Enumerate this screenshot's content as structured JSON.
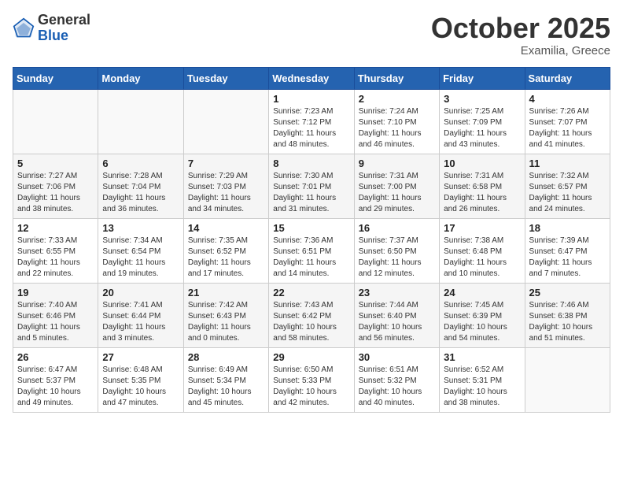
{
  "header": {
    "logo_general": "General",
    "logo_blue": "Blue",
    "month": "October 2025",
    "location": "Examilia, Greece"
  },
  "days_of_week": [
    "Sunday",
    "Monday",
    "Tuesday",
    "Wednesday",
    "Thursday",
    "Friday",
    "Saturday"
  ],
  "weeks": [
    [
      {
        "day": "",
        "detail": ""
      },
      {
        "day": "",
        "detail": ""
      },
      {
        "day": "",
        "detail": ""
      },
      {
        "day": "1",
        "detail": "Sunrise: 7:23 AM\nSunset: 7:12 PM\nDaylight: 11 hours\nand 48 minutes."
      },
      {
        "day": "2",
        "detail": "Sunrise: 7:24 AM\nSunset: 7:10 PM\nDaylight: 11 hours\nand 46 minutes."
      },
      {
        "day": "3",
        "detail": "Sunrise: 7:25 AM\nSunset: 7:09 PM\nDaylight: 11 hours\nand 43 minutes."
      },
      {
        "day": "4",
        "detail": "Sunrise: 7:26 AM\nSunset: 7:07 PM\nDaylight: 11 hours\nand 41 minutes."
      }
    ],
    [
      {
        "day": "5",
        "detail": "Sunrise: 7:27 AM\nSunset: 7:06 PM\nDaylight: 11 hours\nand 38 minutes."
      },
      {
        "day": "6",
        "detail": "Sunrise: 7:28 AM\nSunset: 7:04 PM\nDaylight: 11 hours\nand 36 minutes."
      },
      {
        "day": "7",
        "detail": "Sunrise: 7:29 AM\nSunset: 7:03 PM\nDaylight: 11 hours\nand 34 minutes."
      },
      {
        "day": "8",
        "detail": "Sunrise: 7:30 AM\nSunset: 7:01 PM\nDaylight: 11 hours\nand 31 minutes."
      },
      {
        "day": "9",
        "detail": "Sunrise: 7:31 AM\nSunset: 7:00 PM\nDaylight: 11 hours\nand 29 minutes."
      },
      {
        "day": "10",
        "detail": "Sunrise: 7:31 AM\nSunset: 6:58 PM\nDaylight: 11 hours\nand 26 minutes."
      },
      {
        "day": "11",
        "detail": "Sunrise: 7:32 AM\nSunset: 6:57 PM\nDaylight: 11 hours\nand 24 minutes."
      }
    ],
    [
      {
        "day": "12",
        "detail": "Sunrise: 7:33 AM\nSunset: 6:55 PM\nDaylight: 11 hours\nand 22 minutes."
      },
      {
        "day": "13",
        "detail": "Sunrise: 7:34 AM\nSunset: 6:54 PM\nDaylight: 11 hours\nand 19 minutes."
      },
      {
        "day": "14",
        "detail": "Sunrise: 7:35 AM\nSunset: 6:52 PM\nDaylight: 11 hours\nand 17 minutes."
      },
      {
        "day": "15",
        "detail": "Sunrise: 7:36 AM\nSunset: 6:51 PM\nDaylight: 11 hours\nand 14 minutes."
      },
      {
        "day": "16",
        "detail": "Sunrise: 7:37 AM\nSunset: 6:50 PM\nDaylight: 11 hours\nand 12 minutes."
      },
      {
        "day": "17",
        "detail": "Sunrise: 7:38 AM\nSunset: 6:48 PM\nDaylight: 11 hours\nand 10 minutes."
      },
      {
        "day": "18",
        "detail": "Sunrise: 7:39 AM\nSunset: 6:47 PM\nDaylight: 11 hours\nand 7 minutes."
      }
    ],
    [
      {
        "day": "19",
        "detail": "Sunrise: 7:40 AM\nSunset: 6:46 PM\nDaylight: 11 hours\nand 5 minutes."
      },
      {
        "day": "20",
        "detail": "Sunrise: 7:41 AM\nSunset: 6:44 PM\nDaylight: 11 hours\nand 3 minutes."
      },
      {
        "day": "21",
        "detail": "Sunrise: 7:42 AM\nSunset: 6:43 PM\nDaylight: 11 hours\nand 0 minutes."
      },
      {
        "day": "22",
        "detail": "Sunrise: 7:43 AM\nSunset: 6:42 PM\nDaylight: 10 hours\nand 58 minutes."
      },
      {
        "day": "23",
        "detail": "Sunrise: 7:44 AM\nSunset: 6:40 PM\nDaylight: 10 hours\nand 56 minutes."
      },
      {
        "day": "24",
        "detail": "Sunrise: 7:45 AM\nSunset: 6:39 PM\nDaylight: 10 hours\nand 54 minutes."
      },
      {
        "day": "25",
        "detail": "Sunrise: 7:46 AM\nSunset: 6:38 PM\nDaylight: 10 hours\nand 51 minutes."
      }
    ],
    [
      {
        "day": "26",
        "detail": "Sunrise: 6:47 AM\nSunset: 5:37 PM\nDaylight: 10 hours\nand 49 minutes."
      },
      {
        "day": "27",
        "detail": "Sunrise: 6:48 AM\nSunset: 5:35 PM\nDaylight: 10 hours\nand 47 minutes."
      },
      {
        "day": "28",
        "detail": "Sunrise: 6:49 AM\nSunset: 5:34 PM\nDaylight: 10 hours\nand 45 minutes."
      },
      {
        "day": "29",
        "detail": "Sunrise: 6:50 AM\nSunset: 5:33 PM\nDaylight: 10 hours\nand 42 minutes."
      },
      {
        "day": "30",
        "detail": "Sunrise: 6:51 AM\nSunset: 5:32 PM\nDaylight: 10 hours\nand 40 minutes."
      },
      {
        "day": "31",
        "detail": "Sunrise: 6:52 AM\nSunset: 5:31 PM\nDaylight: 10 hours\nand 38 minutes."
      },
      {
        "day": "",
        "detail": ""
      }
    ]
  ]
}
